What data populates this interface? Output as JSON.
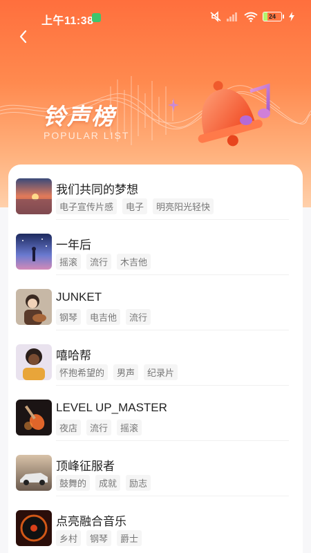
{
  "status_bar": {
    "time": "上午11:38",
    "battery": "24",
    "battery_level": 0.24
  },
  "header": {
    "title": "铃声榜",
    "subtitle": "POPULAR LIST",
    "back_icon": "chevron-left-icon"
  },
  "colors": {
    "hero_top": "#ff6f3d",
    "hero_bottom": "#ffd0ab",
    "tag_bg": "#f5f5f5",
    "tag_text": "#777777"
  },
  "songs": [
    {
      "title": "我们共同的梦想",
      "tags": [
        "电子宣传片感",
        "电子",
        "明亮阳光轻快"
      ],
      "cover": "sunset-beach"
    },
    {
      "title": "一年后",
      "tags": [
        "摇滚",
        "流行",
        "木吉他"
      ],
      "cover": "girl-night-sky"
    },
    {
      "title": "JUNKET",
      "tags": [
        "钢琴",
        "电吉他",
        "流行"
      ],
      "cover": "boy-guitar"
    },
    {
      "title": "嘻哈帮",
      "tags": [
        "怀抱希望的",
        "男声",
        "纪录片"
      ],
      "cover": "cartoon-man"
    },
    {
      "title": "LEVEL UP_MASTER",
      "tags": [
        "夜店",
        "流行",
        "摇滚"
      ],
      "cover": "flaming-guitar"
    },
    {
      "title": "顶峰征服者",
      "tags": [
        "鼓舞的",
        "成就",
        "励志"
      ],
      "cover": "sports-car"
    },
    {
      "title": "点亮融合音乐",
      "tags": [
        "乡村",
        "钢琴",
        "爵士"
      ],
      "cover": "vinyl-fire"
    }
  ]
}
